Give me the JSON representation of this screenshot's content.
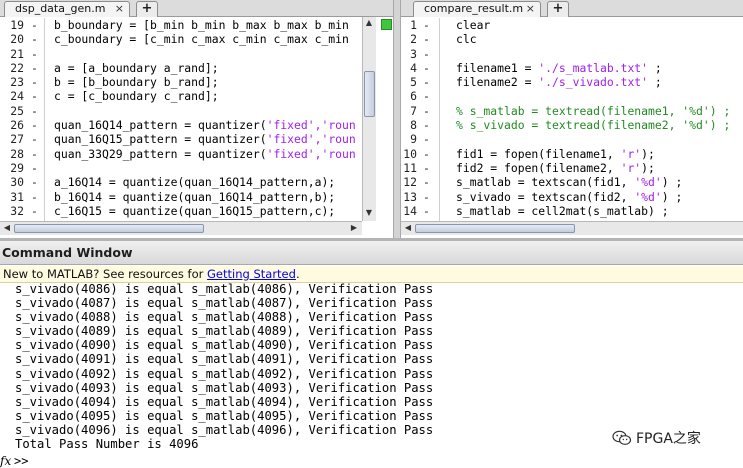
{
  "left_editor": {
    "tab_label": "dsp_data_gen.m",
    "tab_close": "×",
    "add_tab": "+",
    "lines": [
      {
        "n": "19",
        "text": "b_boundary = [b_min b_min b_max b_max b_min"
      },
      {
        "n": "20",
        "text": "c_boundary = [c_min c_max c_min c_max c_min"
      },
      {
        "n": "21",
        "text": ""
      },
      {
        "n": "22",
        "text": "a = [a_boundary a_rand];"
      },
      {
        "n": "23",
        "text": "b = [b_boundary b_rand];"
      },
      {
        "n": "24",
        "text": "c = [c_boundary c_rand];"
      },
      {
        "n": "25",
        "text": ""
      },
      {
        "n": "26",
        "text": "quan_16Q14_pattern = quantizer(",
        "str": "'fixed','roun"
      },
      {
        "n": "27",
        "text": "quan_16Q15_pattern = quantizer(",
        "str": "'fixed','roun"
      },
      {
        "n": "28",
        "text": "quan_33Q29_pattern = quantizer(",
        "str": "'fixed','roun"
      },
      {
        "n": "29",
        "text": ""
      },
      {
        "n": "30",
        "text": "a_16Q14 = quantize(quan_16Q14_pattern,a);"
      },
      {
        "n": "31",
        "text": "b_16Q14 = quantize(quan_16Q14_pattern,b);"
      },
      {
        "n": "32",
        "text": "c_16Q15 = quantize(quan_16Q15_pattern,c);"
      }
    ],
    "dash": "-"
  },
  "right_editor": {
    "tab_label": "compare_result.m",
    "tab_close": "×",
    "add_tab": "+",
    "lines": [
      {
        "n": "1",
        "parts": [
          {
            "t": "clear"
          }
        ]
      },
      {
        "n": "2",
        "parts": [
          {
            "t": "clc"
          }
        ]
      },
      {
        "n": "3",
        "parts": []
      },
      {
        "n": "4",
        "parts": [
          {
            "t": "filename1 = "
          },
          {
            "t": "'./s_matlab.txt'",
            "c": "str"
          },
          {
            "t": " ;"
          }
        ]
      },
      {
        "n": "5",
        "parts": [
          {
            "t": "filename2 = "
          },
          {
            "t": "'./s_vivado.txt'",
            "c": "str"
          },
          {
            "t": " ;"
          }
        ]
      },
      {
        "n": "6",
        "parts": []
      },
      {
        "n": "7",
        "parts": [
          {
            "t": "% s_matlab = textread(filename1, '%d') ;",
            "c": "cmt"
          }
        ]
      },
      {
        "n": "8",
        "parts": [
          {
            "t": "% s_vivado = textread(filename2, '%d') ;",
            "c": "cmt"
          }
        ]
      },
      {
        "n": "9",
        "parts": []
      },
      {
        "n": "10",
        "parts": [
          {
            "t": "fid1 = fopen(filename1, "
          },
          {
            "t": "'r'",
            "c": "str"
          },
          {
            "t": ");"
          }
        ]
      },
      {
        "n": "11",
        "parts": [
          {
            "t": "fid2 = fopen(filename2, "
          },
          {
            "t": "'r'",
            "c": "str"
          },
          {
            "t": ");"
          }
        ]
      },
      {
        "n": "12",
        "parts": [
          {
            "t": "s_matlab = textscan(fid1, "
          },
          {
            "t": "'%d'",
            "c": "str"
          },
          {
            "t": ") ;"
          }
        ]
      },
      {
        "n": "13",
        "parts": [
          {
            "t": "s_vivado = textscan(fid2, "
          },
          {
            "t": "'%d'",
            "c": "str"
          },
          {
            "t": ") ;"
          }
        ]
      },
      {
        "n": "14",
        "parts": [
          {
            "t": "s_matlab = cell2mat(s_matlab) ;"
          }
        ]
      }
    ],
    "dash": "-"
  },
  "command_window": {
    "title": "Command Window",
    "new_prefix": "New to MATLAB? See resources for ",
    "new_link": "Getting Started",
    "new_suffix": ".",
    "output": [
      "s_vivado(4086) is equal s_matlab(4086), Verification Pass",
      "s_vivado(4087) is equal s_matlab(4087), Verification Pass",
      "s_vivado(4088) is equal s_matlab(4088), Verification Pass",
      "s_vivado(4089) is equal s_matlab(4089), Verification Pass",
      "s_vivado(4090) is equal s_matlab(4090), Verification Pass",
      "s_vivado(4091) is equal s_matlab(4091), Verification Pass",
      "s_vivado(4092) is equal s_matlab(4092), Verification Pass",
      "s_vivado(4093) is equal s_matlab(4093), Verification Pass",
      "s_vivado(4094) is equal s_matlab(4094), Verification Pass",
      "s_vivado(4095) is equal s_matlab(4095), Verification Pass",
      "s_vivado(4096) is equal s_matlab(4096), Verification Pass",
      "Total Pass Number is 4096"
    ],
    "fx": "fx",
    "prompt": ">>"
  },
  "watermark": {
    "text": "FPGA之家",
    "icon": "wechat-icon"
  },
  "colors": {
    "string": "#a020f0",
    "comment": "#228b22",
    "status_ok": "#3ec63e",
    "link": "#0000ee"
  }
}
